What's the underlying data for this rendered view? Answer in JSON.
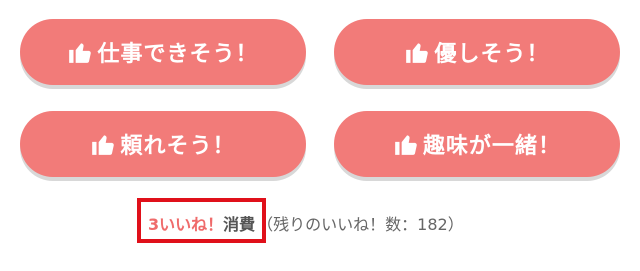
{
  "buttons": [
    {
      "label": "仕事できそう！",
      "icon": "thumbs-up-icon"
    },
    {
      "label": "優しそう！",
      "icon": "thumbs-up-icon"
    },
    {
      "label": "頼れそう！",
      "icon": "thumbs-up-icon"
    },
    {
      "label": "趣味が一緒！",
      "icon": "thumbs-up-icon"
    }
  ],
  "consumption": {
    "count_text": "3いいね！",
    "consume_text": "消費",
    "remaining_text": "（残りのいいね！数：182）"
  },
  "colors": {
    "button_bg": "#f27b79",
    "button_text": "#ffffff",
    "count_text": "#ef6b6b",
    "highlight_border": "#e0101a"
  }
}
